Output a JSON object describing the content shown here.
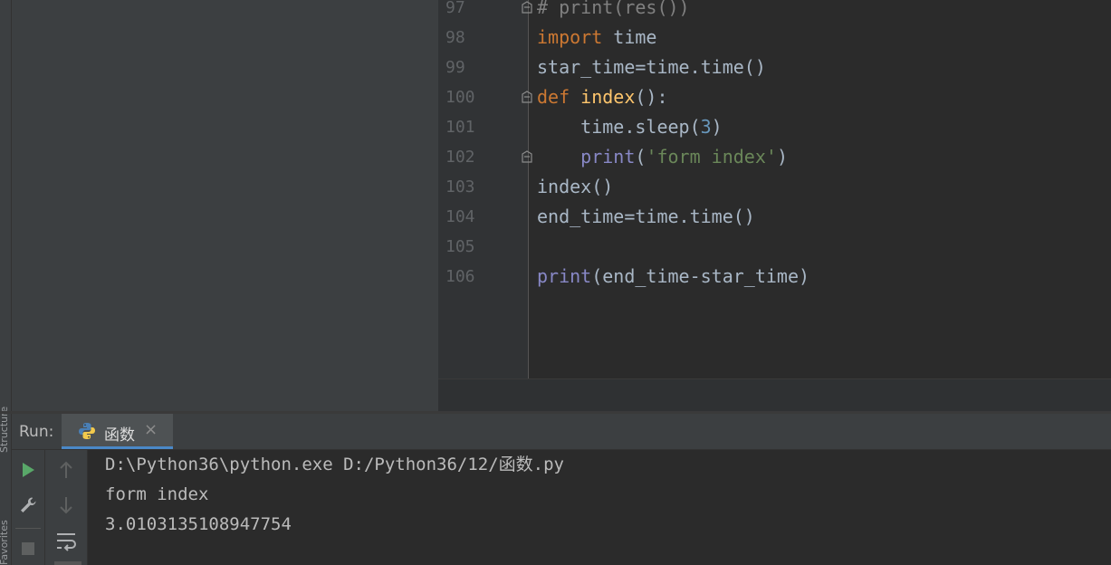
{
  "left_strip": {
    "structure_label": "Structure",
    "favorites_label": "Favorites"
  },
  "editor": {
    "lines": [
      {
        "num": "97",
        "tokens": [
          {
            "t": "# print(res())",
            "c": "cmt"
          }
        ]
      },
      {
        "num": "98",
        "tokens": [
          {
            "t": "import",
            "c": "kw"
          },
          {
            "t": " time",
            "c": ""
          }
        ]
      },
      {
        "num": "99",
        "tokens": [
          {
            "t": "star_time=time.time()",
            "c": ""
          }
        ]
      },
      {
        "num": "100",
        "tokens": [
          {
            "t": "def",
            "c": "kw"
          },
          {
            "t": " ",
            "c": ""
          },
          {
            "t": "index",
            "c": "fn"
          },
          {
            "t": "():",
            "c": ""
          }
        ]
      },
      {
        "num": "101",
        "tokens": [
          {
            "t": "    time.sleep(",
            "c": ""
          },
          {
            "t": "3",
            "c": "num"
          },
          {
            "t": ")",
            "c": ""
          }
        ]
      },
      {
        "num": "102",
        "tokens": [
          {
            "t": "    ",
            "c": ""
          },
          {
            "t": "print",
            "c": "bi"
          },
          {
            "t": "(",
            "c": ""
          },
          {
            "t": "'form index'",
            "c": "str"
          },
          {
            "t": ")",
            "c": ""
          }
        ]
      },
      {
        "num": "103",
        "tokens": [
          {
            "t": "index()",
            "c": ""
          }
        ]
      },
      {
        "num": "104",
        "tokens": [
          {
            "t": "end_time=time.time()",
            "c": ""
          }
        ]
      },
      {
        "num": "105",
        "tokens": []
      },
      {
        "num": "106",
        "tokens": [
          {
            "t": "print",
            "c": "bi"
          },
          {
            "t": "(end_time-star_time)",
            "c": ""
          }
        ]
      }
    ]
  },
  "run_panel": {
    "label": "Run:",
    "tab_label": "函数",
    "tab_close": "×",
    "console_lines": [
      "D:\\Python36\\python.exe D:/Python36/12/函数.py",
      "form index",
      "3.0103135108947754"
    ]
  },
  "colors": {
    "background": "#2b2b2b",
    "panel": "#3c3f41",
    "keyword": "#cc7832",
    "function": "#ffc66d",
    "builtin": "#8888c6",
    "number": "#6897bb",
    "string": "#6a8759",
    "comment": "#808080",
    "run_icon": "#59a869"
  },
  "icons": [
    "python-file-icon",
    "close-icon",
    "run-icon",
    "wrench-icon",
    "stop-icon",
    "arrow-up-icon",
    "arrow-down-icon",
    "soft-wrap-icon",
    "fold-marker-icon"
  ]
}
